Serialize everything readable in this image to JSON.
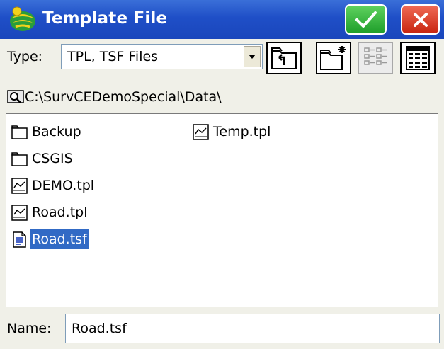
{
  "window": {
    "title": "Template File",
    "app_icon": "carlson-logo-icon",
    "ok_icon": "checkmark-icon",
    "close_icon": "close-icon",
    "colors": {
      "titlebar": "#1f4fc7",
      "ok": "#1e9e2a",
      "close": "#c8250f",
      "selection": "#316ac5"
    }
  },
  "type": {
    "label": "Type:",
    "value": "TPL, TSF Files",
    "arrow_icon": "chevron-down-icon"
  },
  "toolbar": {
    "buttons": [
      {
        "icon": "folder-up-icon"
      },
      {
        "icon": "new-folder-icon"
      },
      {
        "icon": "list-view-icon"
      },
      {
        "icon": "details-view-icon"
      }
    ]
  },
  "path": {
    "icon": "drive-search-icon",
    "text": "C:\\SurvCEDemoSpecial\\Data\\"
  },
  "files": [
    {
      "name": "Backup",
      "kind": "folder",
      "icon": "folder-icon",
      "selected": false
    },
    {
      "name": "CSGIS",
      "kind": "folder",
      "icon": "folder-icon",
      "selected": false
    },
    {
      "name": "DEMO.tpl",
      "kind": "tpl",
      "icon": "template-file-icon",
      "selected": false
    },
    {
      "name": "Road.tpl",
      "kind": "tpl",
      "icon": "template-file-icon",
      "selected": false
    },
    {
      "name": "Road.tsf",
      "kind": "tsf",
      "icon": "tsf-file-icon",
      "selected": true
    },
    {
      "name": "Temp.tpl",
      "kind": "tpl",
      "icon": "template-file-icon",
      "selected": false
    }
  ],
  "name": {
    "label": "Name:",
    "value": "Road.tsf"
  }
}
